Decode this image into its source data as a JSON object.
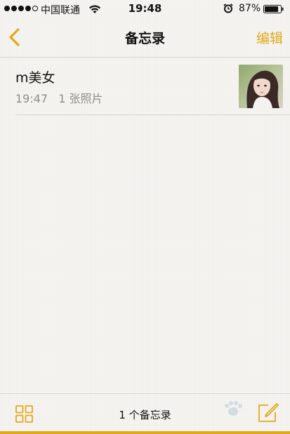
{
  "status_bar": {
    "signal_bars_filled": 4,
    "signal_bars_total": 5,
    "carrier": "中国联通",
    "time": "19:48",
    "battery_percent": "87%",
    "battery_level": 0.87
  },
  "nav": {
    "title": "备忘录",
    "edit_label": "编辑"
  },
  "notes": [
    {
      "title": "m美女",
      "time": "19:47",
      "attachments": "1 张照片"
    }
  ],
  "toolbar": {
    "count_label": "1 个备忘录"
  },
  "colors": {
    "accent": "#e3a818",
    "text_primary": "#111111",
    "text_secondary": "#8e8d8a",
    "separator": "#d4d3d0"
  },
  "icons": {
    "back": "chevron-left-icon",
    "folders": "grid-icon",
    "compose": "compose-icon",
    "wifi": "wifi-icon",
    "alarm": "alarm-icon",
    "battery": "battery-icon"
  }
}
